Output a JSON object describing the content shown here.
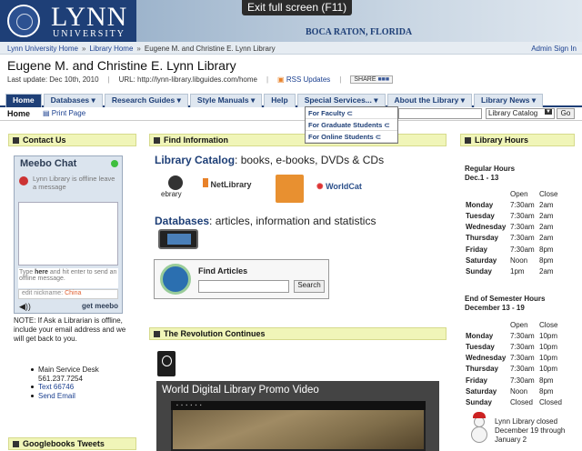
{
  "banner": {
    "logo_name": "LYNN",
    "logo_sub": "UNIVERSITY",
    "location": "BOCA RATON, FLORIDA"
  },
  "overlay": {
    "exit_fullscreen": "Exit full screen (F11)"
  },
  "breadcrumb": {
    "items": [
      "Lynn University Home",
      "Library Home",
      "Eugene M. and Christine E. Lynn Library"
    ],
    "separator": "»",
    "admin": "Admin Sign In"
  },
  "page": {
    "title": "Eugene M. and Christine E. Lynn Library",
    "last_update": "Last update: Dec 10th, 2010",
    "url": "URL: http://lynn-library.libguides.com/home",
    "rss": "RSS Updates",
    "share": "SHARE"
  },
  "nav": {
    "tabs": [
      "Home",
      "Databases",
      "Research Guides",
      "Style Manuals",
      "Help",
      "Special Services...",
      "About the Library",
      "Library News"
    ]
  },
  "dropdown": {
    "items": [
      "For Faculty",
      "For Graduate Students",
      "For Online Students"
    ]
  },
  "subbar": {
    "home": "Home",
    "print": "Print Page",
    "select": "Library Catalog",
    "go": "Go"
  },
  "contact": {
    "title": "Contact Us"
  },
  "meebo": {
    "title": "Meebo Chat",
    "status": "Lynn Library is offline leave a message",
    "type_hint_1": "Type ",
    "type_hint_here": "here",
    "type_hint_2": " and hit enter to send an offline message.",
    "nick_label": "edit nickname: ",
    "nick_value": "China",
    "speaker": "◀))",
    "brand": "get meebo"
  },
  "note": "NOTE:  If Ask a Librarian is offline, include your email address and we will get back to you.",
  "desk": {
    "name": "Main Service Desk",
    "phone": "561.237.7254",
    "text": "Text  66746",
    "email": "Send Email"
  },
  "googlebooks": {
    "title": "Googlebooks Tweets"
  },
  "find_info": {
    "title": "Find Information",
    "catalog_bold": "Library Catalog",
    "catalog_rest": ": books, e-books, DVDs & CDs",
    "logos": [
      "ebrary",
      "NetLibrary",
      "WorldCat"
    ],
    "db_bold": "Databases",
    "db_rest": ": articles, information and statistics",
    "find_articles": "Find Articles",
    "search_btn": "Search"
  },
  "revolution": {
    "title": "The Revolution Continues",
    "video_title": "World Digital Library Promo Video"
  },
  "hours": {
    "title": "Library Hours",
    "regular_head": "Regular Hours",
    "regular_dates": "Dec.1 - 13",
    "col_open": "Open",
    "col_close": "Close",
    "regular": [
      [
        "Monday",
        "7:30am",
        "2am"
      ],
      [
        "Tuesday",
        "7:30am",
        "2am"
      ],
      [
        "Wednesday",
        "7:30am",
        "2am"
      ],
      [
        "Thursday",
        "7:30am",
        "2am"
      ],
      [
        "Friday",
        "7:30am",
        "8pm"
      ],
      [
        "Saturday",
        "Noon",
        "8pm"
      ],
      [
        "Sunday",
        "1pm",
        "2am"
      ]
    ],
    "exam_head": "End of Semester Hours",
    "exam_dates": "December 13 - 19",
    "exam": [
      [
        "Monday",
        "7:30am",
        "10pm"
      ],
      [
        "Tuesday",
        "7:30am",
        "10pm"
      ],
      [
        "Wednesday",
        "7:30am",
        "10pm"
      ],
      [
        "Thursday",
        "7:30am",
        "10pm"
      ],
      [
        "Friday",
        "7:30am",
        "8pm"
      ],
      [
        "Saturday",
        "Noon",
        "8pm"
      ],
      [
        "Sunday",
        "Closed",
        "Closed"
      ]
    ],
    "closed_note": "Lynn Library closed December 19 through January 2"
  }
}
